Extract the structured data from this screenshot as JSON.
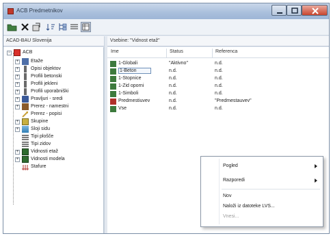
{
  "window": {
    "title": "ACB Predmetnikov"
  },
  "left_pane": {
    "header": "ACAD-BAU Slovenija"
  },
  "right_pane": {
    "header": "Vsebine: \"Vidnost etaž\""
  },
  "tree": {
    "root": "ACB",
    "items": [
      {
        "label": "Etaže",
        "icon": "floors-icon",
        "color": "#4f6fa8"
      },
      {
        "label": "Opisi objektov",
        "icon": "objects-icon",
        "color": "#6a6a6a"
      },
      {
        "label": "Profili betonski",
        "icon": "concrete-profile-icon",
        "color": "#6a6a6a"
      },
      {
        "label": "Profili jekleni",
        "icon": "steel-profile-icon",
        "color": "#6a6a6a"
      },
      {
        "label": "Profili uporabniški",
        "icon": "user-profile-icon",
        "color": "#6a6a6a"
      },
      {
        "label": "Pravljuri - sredi",
        "icon": "section-middle-icon",
        "color": "#3b5a99"
      },
      {
        "label": "Prerez - namestni",
        "icon": "section-placement-icon",
        "color": "#8a5a2a"
      },
      {
        "label": "Prerez - popisi",
        "icon": "section-list-icon",
        "color": "#c9a23a"
      },
      {
        "label": "Skupine",
        "icon": "groups-icon",
        "color": "#c8b040"
      },
      {
        "label": "Sloji sidu",
        "icon": "layers-icon",
        "color": "#2f7fb5"
      },
      {
        "label": "Tipi plošče",
        "icon": "slab-types-icon",
        "color": "#2a2a2a"
      },
      {
        "label": "Tipi zidov",
        "icon": "wall-types-icon",
        "color": "#2a2a2a"
      },
      {
        "label": "Vidnosti etaž",
        "icon": "floor-visibility-icon",
        "color": "#2f6b2f"
      },
      {
        "label": "Vidnosti modela",
        "icon": "model-visibility-icon",
        "color": "#2f6b2f"
      },
      {
        "label": "Stafure",
        "icon": "hatch-icon",
        "color": "#b0302a"
      }
    ]
  },
  "table": {
    "columns": {
      "name": "Ime",
      "status": "Status",
      "reference": "Referenca"
    },
    "rows": [
      {
        "name": "1-Globali",
        "status": "\"Aktivno\"",
        "reference": "n.d.",
        "icon": "visibility-icon",
        "color": "#3d7a3d"
      },
      {
        "name": "1-Beton",
        "status": "n.d.",
        "reference": "n.d.",
        "icon": "visibility-icon",
        "color": "#3d7a3d"
      },
      {
        "name": "1-Stopnice",
        "status": "n.d.",
        "reference": "n.d.",
        "icon": "visibility-icon",
        "color": "#3d7a3d"
      },
      {
        "name": "1-Zid oporni",
        "status": "n.d.",
        "reference": "n.d.",
        "icon": "visibility-icon",
        "color": "#3d7a3d"
      },
      {
        "name": "1-Simboli",
        "status": "n.d.",
        "reference": "n.d.",
        "icon": "visibility-icon",
        "color": "#3d7a3d"
      },
      {
        "name": "Predmestiuvev",
        "status": "n.d.",
        "reference": "\"Predmestauvev\"",
        "icon": "visibility-icon",
        "color": "#b0302a"
      },
      {
        "name": "Vse",
        "status": "n.d.",
        "reference": "n.d.",
        "icon": "visibility-icon",
        "color": "#3d7a3d"
      }
    ]
  },
  "context_menu": {
    "items": [
      {
        "label": "Pogled",
        "submenu": true,
        "enabled": true
      },
      {
        "label": "Razporedi",
        "submenu": true,
        "enabled": true
      },
      {
        "label": "Nov",
        "submenu": false,
        "enabled": true
      },
      {
        "label": "Naloži iz datoteke LVS...",
        "submenu": false,
        "enabled": true
      },
      {
        "label": "Vnesi...",
        "submenu": false,
        "enabled": false
      }
    ]
  }
}
